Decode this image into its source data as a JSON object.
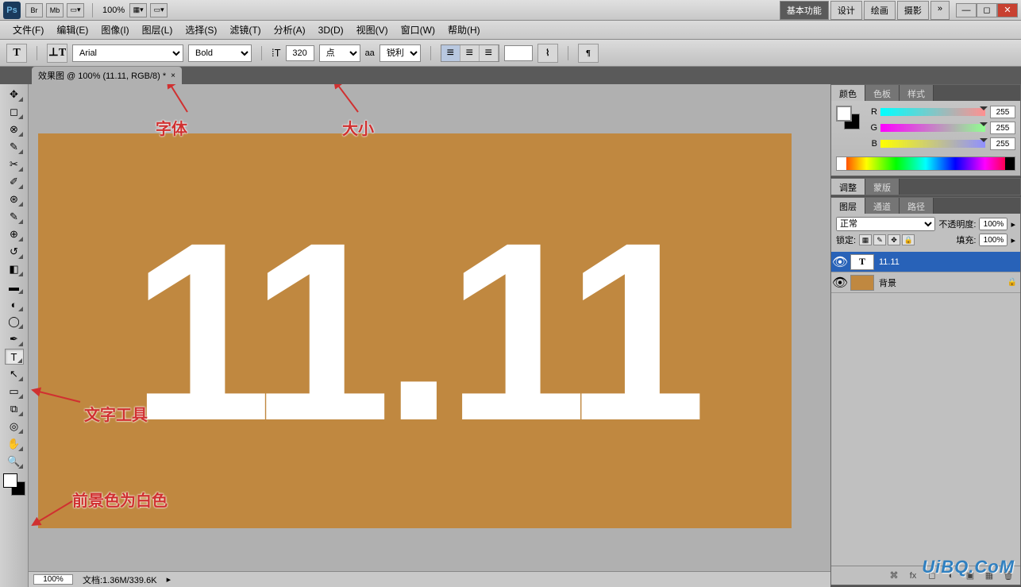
{
  "app_bar": {
    "br_label": "Br",
    "mb_label": "Mb",
    "zoom": "100%",
    "workspace_tabs": [
      "基本功能",
      "设计",
      "绘画",
      "摄影"
    ],
    "more": "»"
  },
  "menu": [
    "文件(F)",
    "编辑(E)",
    "图像(I)",
    "图层(L)",
    "选择(S)",
    "滤镜(T)",
    "分析(A)",
    "3D(D)",
    "视图(V)",
    "窗口(W)",
    "帮助(H)"
  ],
  "options": {
    "font_family": "Arial",
    "font_style": "Bold",
    "font_size": "320",
    "size_unit": "点",
    "aa_label": "aa",
    "aa_mode": "锐利",
    "tool_glyph": "T"
  },
  "doc_tab": {
    "title": "效果图 @ 100% (11.11, RGB/8) *",
    "close": "×"
  },
  "canvas": {
    "text": "11.11"
  },
  "annotations": {
    "font": "字体",
    "size": "大小",
    "text_tool": "文字工具",
    "fg_white": "前景色为白色"
  },
  "panels": {
    "color": {
      "tabs": [
        "颜色",
        "色板",
        "样式"
      ],
      "r_label": "R",
      "g_label": "G",
      "b_label": "B",
      "r": "255",
      "g": "255",
      "b": "255"
    },
    "adjust": {
      "tabs": [
        "调整",
        "蒙版"
      ]
    },
    "layers": {
      "tabs": [
        "图层",
        "通道",
        "路径"
      ],
      "blend_mode": "正常",
      "opacity_label": "不透明度:",
      "opacity": "100%",
      "lock_label": "锁定:",
      "fill_label": "填充:",
      "fill": "100%",
      "items": [
        {
          "name": "11.11",
          "type": "text"
        },
        {
          "name": "背景",
          "type": "bg"
        }
      ]
    }
  },
  "status": {
    "zoom": "100%",
    "doc_info": "文档:1.36M/339.6K"
  },
  "watermark": "UiBQ.CoM"
}
